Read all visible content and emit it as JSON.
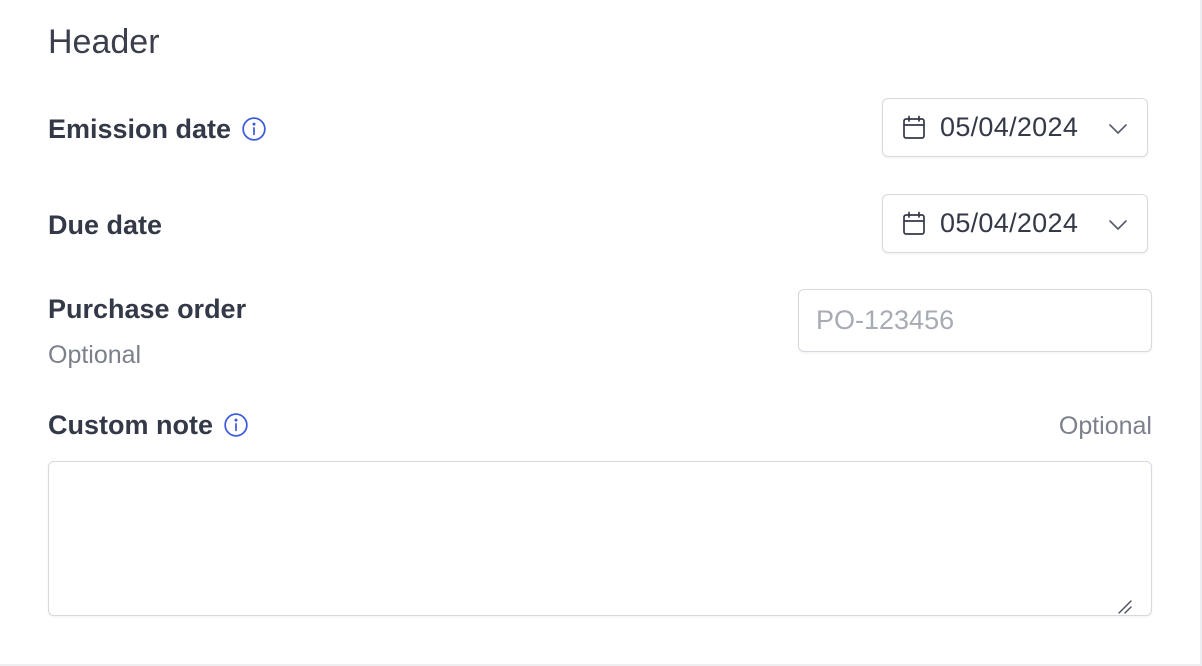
{
  "section": {
    "title": "Header"
  },
  "emission": {
    "label": "Emission date",
    "info_icon": "info-circle-icon",
    "date": "05/04/2024",
    "calendar_icon": "calendar-icon",
    "chevron_icon": "chevron-down-icon"
  },
  "due": {
    "label": "Due date",
    "date": "05/04/2024",
    "calendar_icon": "calendar-icon",
    "chevron_icon": "chevron-down-icon"
  },
  "purchase_order": {
    "label": "Purchase order",
    "optional_label": "Optional",
    "value": "",
    "placeholder": "PO-123456"
  },
  "custom_note": {
    "label": "Custom note",
    "info_icon": "info-circle-icon",
    "optional_label": "Optional",
    "value": ""
  },
  "colors": {
    "accent": "#3b5bdb",
    "text": "#343947",
    "muted": "#7b808b",
    "border": "#d7d9df"
  }
}
